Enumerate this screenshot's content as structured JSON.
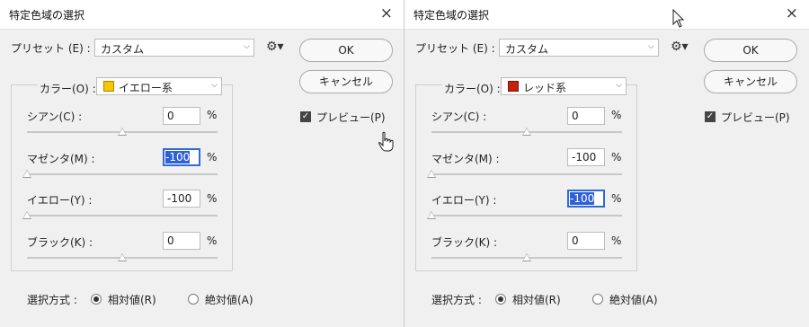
{
  "dialogs": [
    {
      "title": "特定色域の選択",
      "close_icon": "×",
      "preset_label": "プリセット (E) :",
      "preset_value": "カスタム",
      "ok_label": "OK",
      "cancel_label": "キャンセル",
      "preview_label": "プレビュー(P)",
      "preview_checked": true,
      "colors_label": "カラー(O) :",
      "color_value": "イエロー系",
      "color_swatch": "#f7c600",
      "sliders": [
        {
          "label": "シアン(C) :",
          "value": "0",
          "unit": "%",
          "focused": false,
          "thumb_level": 0.5
        },
        {
          "label": "マゼンタ(M) :",
          "value": "-100",
          "unit": "%",
          "focused": true,
          "thumb_level": 0
        },
        {
          "label": "イエロー(Y) :",
          "value": "-100",
          "unit": "%",
          "focused": false,
          "thumb_level": 0
        },
        {
          "label": "ブラック(K) :",
          "value": "0",
          "unit": "%",
          "focused": false,
          "thumb_level": 0.5
        }
      ],
      "method_label": "選択方式 :",
      "method_options": [
        {
          "label": "相対値(R)",
          "selected": true
        },
        {
          "label": "絶対値(A)",
          "selected": false
        }
      ],
      "cursor": "hand-cursor-icon"
    },
    {
      "title": "特定色域の選択",
      "close_icon": "×",
      "preset_label": "プリセット (E) :",
      "preset_value": "カスタム",
      "ok_label": "OK",
      "cancel_label": "キャンセル",
      "preview_label": "プレビュー(P)",
      "preview_checked": true,
      "colors_label": "カラー(O) :",
      "color_value": "レッド系",
      "color_swatch": "#c8200e",
      "sliders": [
        {
          "label": "シアン(C) :",
          "value": "0",
          "unit": "%",
          "focused": false,
          "thumb_level": 0.5
        },
        {
          "label": "マゼンタ(M) :",
          "value": "-100",
          "unit": "%",
          "focused": false,
          "thumb_level": 0
        },
        {
          "label": "イエロー(Y) :",
          "value": "-100",
          "unit": "%",
          "focused": true,
          "thumb_level": 0
        },
        {
          "label": "ブラック(K) :",
          "value": "0",
          "unit": "%",
          "focused": false,
          "thumb_level": 0.5
        }
      ],
      "method_label": "選択方式 :",
      "method_options": [
        {
          "label": "相対値(R)",
          "selected": true
        },
        {
          "label": "絶対値(A)",
          "selected": false
        }
      ],
      "cursor": "arrow-cursor-icon"
    }
  ]
}
